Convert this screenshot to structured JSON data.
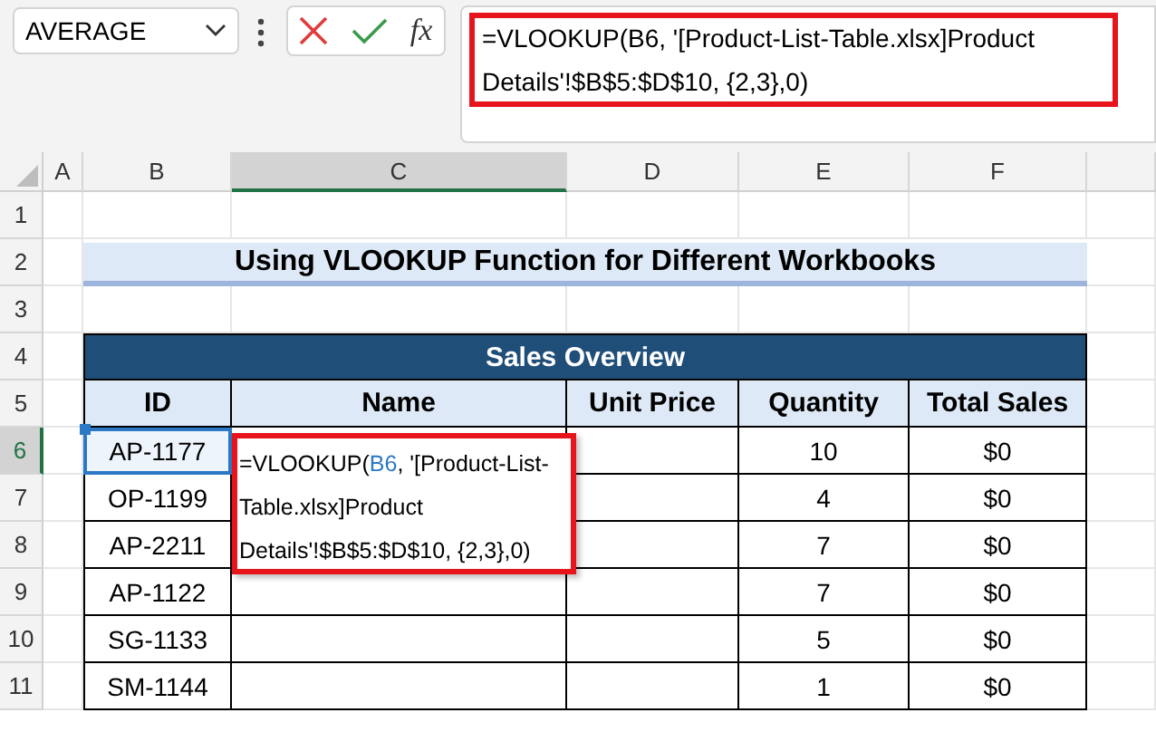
{
  "name_box": {
    "value": "AVERAGE"
  },
  "formula_bar": {
    "insert_function": "fx",
    "formula": "=VLOOKUP(B6, '[Product-List-Table.xlsx]Product Details'!$B$5:$D$10, {2,3},0)",
    "highlighted": true
  },
  "columns": [
    {
      "label": "A",
      "selected": false
    },
    {
      "label": "B",
      "selected": false
    },
    {
      "label": "C",
      "selected": true
    },
    {
      "label": "D",
      "selected": false
    },
    {
      "label": "E",
      "selected": false
    },
    {
      "label": "F",
      "selected": false
    }
  ],
  "rows": [
    {
      "label": "1",
      "selected": false
    },
    {
      "label": "2",
      "selected": false
    },
    {
      "label": "3",
      "selected": false
    },
    {
      "label": "4",
      "selected": false
    },
    {
      "label": "5",
      "selected": false
    },
    {
      "label": "6",
      "selected": true
    },
    {
      "label": "7",
      "selected": false
    },
    {
      "label": "8",
      "selected": false
    },
    {
      "label": "9",
      "selected": false
    },
    {
      "label": "10",
      "selected": false
    },
    {
      "label": "11",
      "selected": false
    }
  ],
  "title": "Using VLOOKUP Function for Different Workbooks",
  "table": {
    "caption": "Sales Overview",
    "columns": [
      "ID",
      "Name",
      "Unit Price",
      "Quantity",
      "Total Sales"
    ],
    "rows": [
      {
        "id": "AP-1177",
        "quantity": "10",
        "total_sales": "$0",
        "referenced": true
      },
      {
        "id": "OP-1199",
        "quantity": "4",
        "total_sales": "$0",
        "referenced": false
      },
      {
        "id": "AP-2211",
        "quantity": "7",
        "total_sales": "$0",
        "referenced": false
      },
      {
        "id": "AP-1122",
        "quantity": "7",
        "total_sales": "$0",
        "referenced": false
      },
      {
        "id": "SG-1133",
        "quantity": "5",
        "total_sales": "$0",
        "referenced": false
      },
      {
        "id": "SM-1144",
        "quantity": "1",
        "total_sales": "$0",
        "referenced": false
      }
    ]
  },
  "editor": {
    "highlighted": true,
    "parts": [
      {
        "kind": "text",
        "text": "=VLOOKUP("
      },
      {
        "kind": "ref",
        "text": "B6"
      },
      {
        "kind": "text",
        "text": ", '[Product-List-Table.xlsx]Product Details'!$B$5:$D$10, {2,3},0)"
      }
    ]
  }
}
